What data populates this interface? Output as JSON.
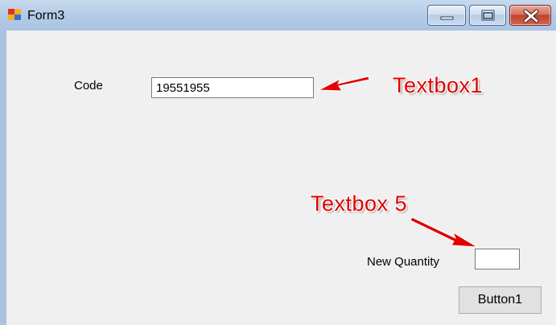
{
  "window": {
    "title": "Form3",
    "buttons": {
      "minimize_icon": "minimize-icon",
      "maximize_icon": "maximize-icon",
      "close_icon": "close-icon"
    }
  },
  "form": {
    "code_label": "Code",
    "code_value": "19551955",
    "new_quantity_label": "New Quantity",
    "new_quantity_value": "",
    "button1_label": "Button1"
  },
  "annotations": {
    "textbox1_label": "Textbox1",
    "textbox5_label": "Textbox 5",
    "color": "#e10000"
  }
}
